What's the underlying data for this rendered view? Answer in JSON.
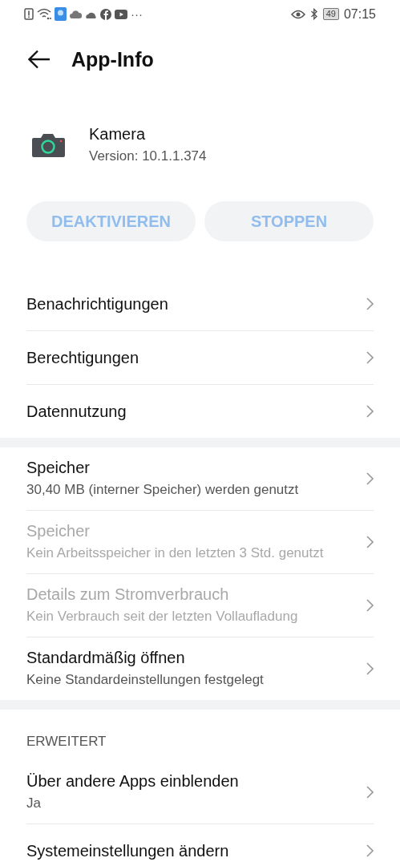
{
  "status_bar": {
    "overflow": "···",
    "battery": "49",
    "time": "07:15"
  },
  "header": {
    "title": "App-Info"
  },
  "app": {
    "name": "Kamera",
    "version": "Version: 10.1.1.374"
  },
  "buttons": [
    {
      "label": "DEAKTIVIEREN",
      "disabled": true
    },
    {
      "label": "STOPPEN",
      "disabled": true
    }
  ],
  "sections": [
    {
      "items": [
        {
          "title": "Benachrichtigungen",
          "disabled": false
        },
        {
          "title": "Berechtigungen",
          "disabled": false
        },
        {
          "title": "Datennutzung",
          "disabled": false
        }
      ]
    },
    {
      "items": [
        {
          "title": "Speicher",
          "subtitle": "30,40 MB (interner Speicher) werden genutzt",
          "disabled": false
        },
        {
          "title": "Speicher",
          "subtitle": "Kein Arbeitsspeicher in den letzten 3 Std. genutzt",
          "disabled": true
        },
        {
          "title": "Details zum Stromverbrauch",
          "subtitle": "Kein Verbrauch seit der letzten Vollaufladung",
          "disabled": true
        },
        {
          "title": "Standardmäßig öffnen",
          "subtitle": "Keine Standardeinstellungen festgelegt",
          "disabled": false
        }
      ]
    },
    {
      "header": "ERWEITERT",
      "items": [
        {
          "title": "Über andere Apps einblenden",
          "subtitle": "Ja",
          "disabled": false
        },
        {
          "title": "Systemeinstellungen ändern",
          "disabled": false
        }
      ]
    }
  ]
}
